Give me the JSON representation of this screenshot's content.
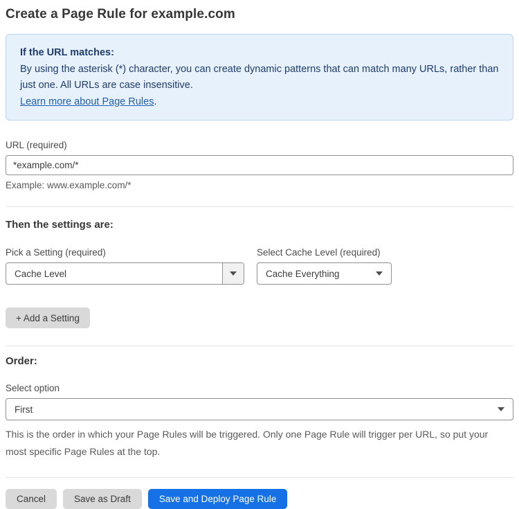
{
  "page": {
    "title": "Create a Page Rule for example.com"
  },
  "info_box": {
    "heading": "If the URL matches:",
    "body": "By using the asterisk (*) character, you can create dynamic patterns that can match many URLs, rather than just one. All URLs are case insensitive.",
    "link_label": "Learn more about Page Rules",
    "link_suffix": "."
  },
  "url_field": {
    "label": "URL (required)",
    "value": "*example.com/*",
    "helper": "Example: www.example.com/*"
  },
  "settings_section": {
    "heading": "Then the settings are:",
    "setting_picker": {
      "label": "Pick a Setting (required)",
      "selected": "Cache Level"
    },
    "cache_level_picker": {
      "label": "Select Cache Level (required)",
      "selected": "Cache Everything"
    },
    "add_setting_label": "+ Add a Setting"
  },
  "order_section": {
    "heading": "Order:",
    "label": "Select option",
    "selected": "First",
    "helper": "This is the order in which your Page Rules will be triggered. Only one Page Rule will trigger per URL, so put your most specific Page Rules at the top."
  },
  "actions": {
    "cancel_label": "Cancel",
    "save_draft_label": "Save as Draft",
    "save_deploy_label": "Save and Deploy Page Rule"
  },
  "colors": {
    "accent_blue": "#1671e6",
    "info_background": "#e7f1fb",
    "info_border": "#bcd5f0",
    "info_text": "#1f3c6d",
    "link_blue": "#2060b2",
    "button_gray": "#d9d9d9"
  }
}
